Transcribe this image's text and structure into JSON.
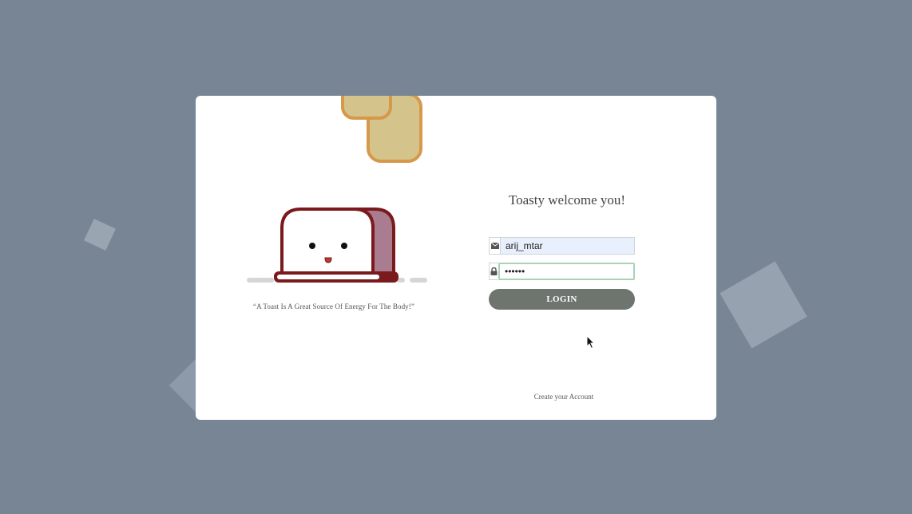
{
  "card": {
    "quote": "“A Toast Is A Great Source Of Energy For The Body!”"
  },
  "login": {
    "title": "Toasty welcome you!",
    "email_value": "arij_mtar",
    "password_value": "••••••",
    "login_label": "LOGIN",
    "create_account_label": "Create your Account"
  },
  "icons": {
    "email": "envelope-icon",
    "password": "lock-icon"
  },
  "colors": {
    "background": "#778595",
    "login_button": "#6e756e",
    "toaster_outline": "#7a1a1d",
    "bread": "#d4c48c",
    "bread_crust": "#d6984a"
  }
}
